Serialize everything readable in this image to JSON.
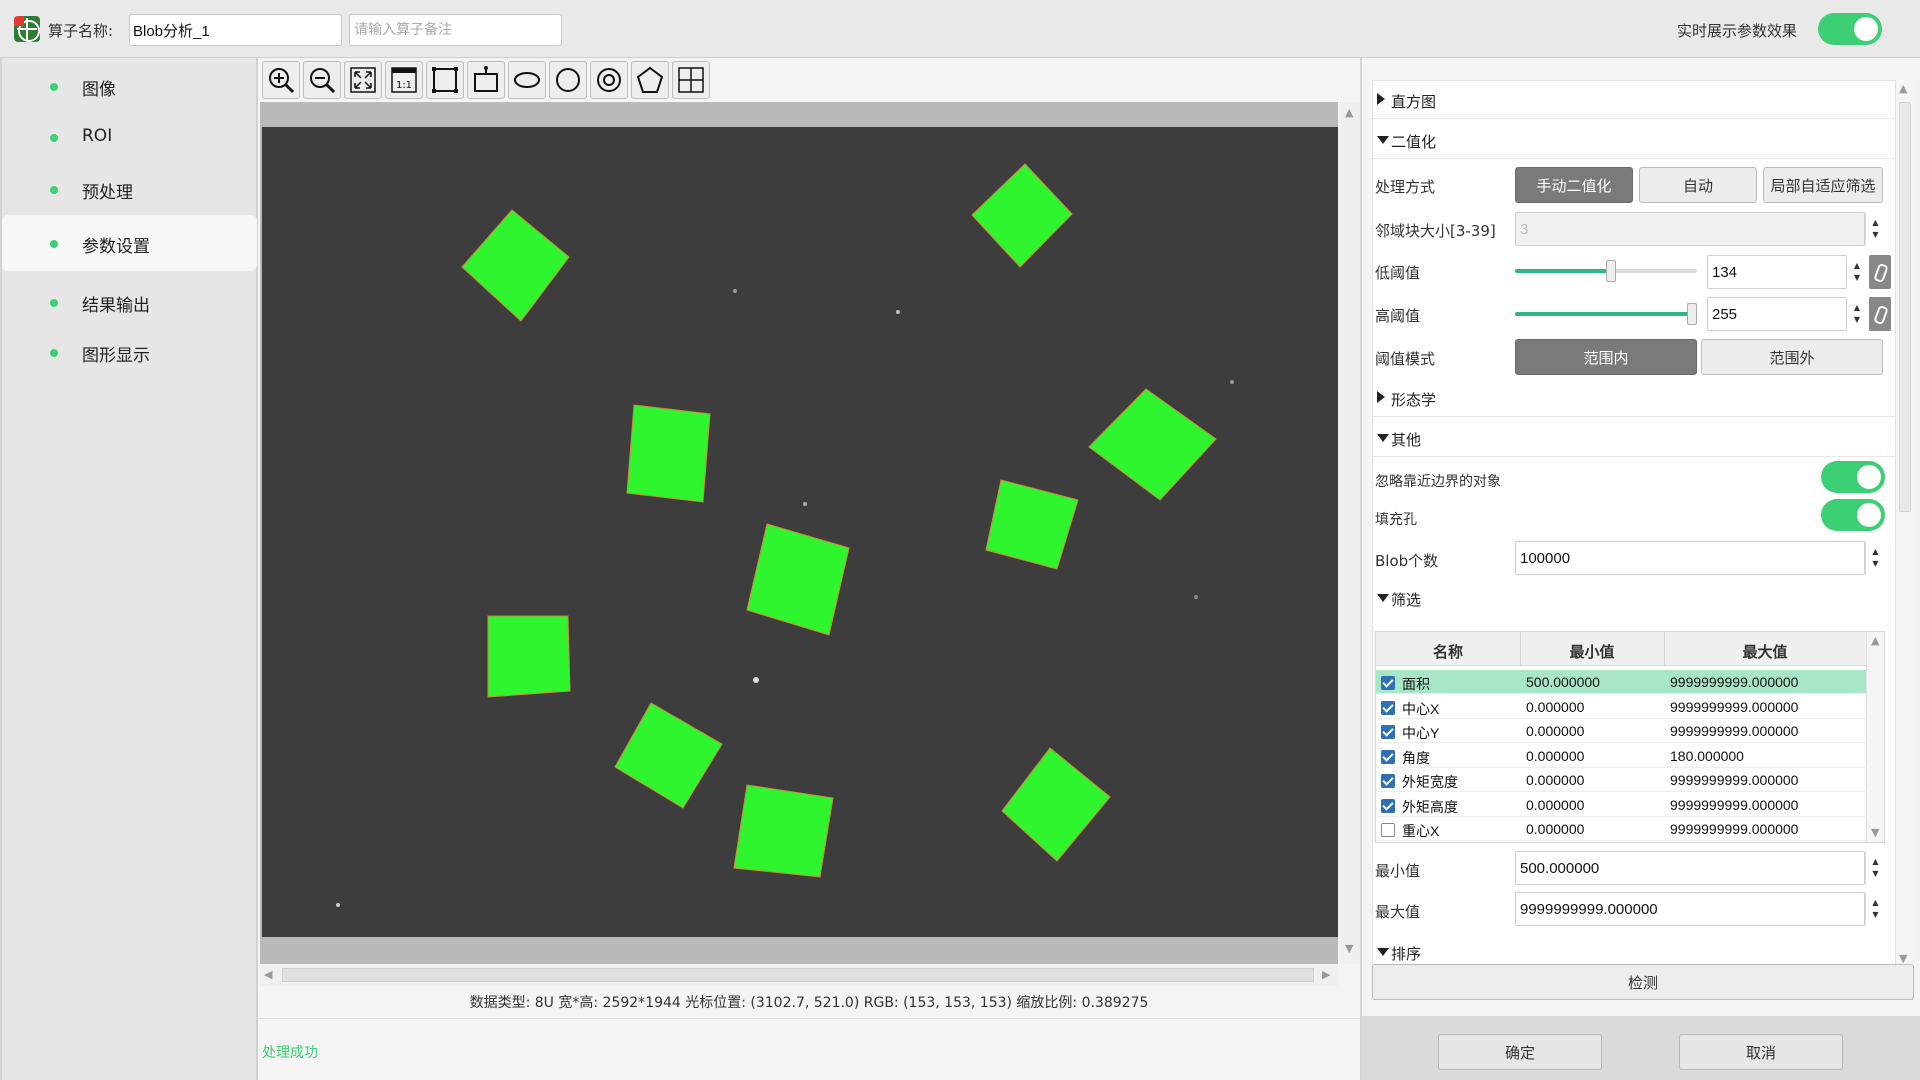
{
  "topbar": {
    "op_name_label": "算子名称:",
    "op_name_value": "Blob分析_1",
    "op_note_placeholder": "请输入算子备注",
    "realtime_label": "实时展示参数效果",
    "realtime_on": true
  },
  "nav": {
    "items": [
      {
        "label": "图像",
        "active": false
      },
      {
        "label": "ROI",
        "active": false
      },
      {
        "label": "预处理",
        "active": false
      },
      {
        "label": "参数设置",
        "active": true
      },
      {
        "label": "结果输出",
        "active": false
      },
      {
        "label": "图形显示",
        "active": false
      }
    ]
  },
  "toolbar": {
    "icons": [
      "zoom-in-icon",
      "zoom-out-icon",
      "fit-window-icon",
      "actual-size-icon",
      "rectangle-icon",
      "rotated-rect-icon",
      "ellipse-icon",
      "circle-icon",
      "annulus-icon",
      "polygon-icon",
      "grid-icon"
    ]
  },
  "status": {
    "info": "数据类型: 8U 宽*高: 2592*1944 光标位置: (3102.7, 521.0) RGB: (153, 153, 153) 缩放比例: 0.389275",
    "result": "处理成功"
  },
  "params": {
    "histogram": "直方图",
    "binarization": "二值化",
    "method_label": "处理方式",
    "methods": [
      "手动二值化",
      "自动",
      "局部自适应筛选"
    ],
    "method_selected": 0,
    "neighbor_label": "邻域块大小[3-39]",
    "neighbor_value": "3",
    "low_label": "低阈值",
    "low_value": "134",
    "low_fraction": 0.525,
    "high_label": "高阈值",
    "high_value": "255",
    "high_fraction": 1.0,
    "mode_label": "阈值模式",
    "modes": [
      "范围内",
      "范围外"
    ],
    "mode_selected": 0,
    "morphology": "形态学",
    "other": "其他",
    "ignore_border_label": "忽略靠近边界的对象",
    "ignore_border_on": true,
    "fill_holes_label": "填充孔",
    "fill_holes_on": true,
    "blob_count_label": "Blob个数",
    "blob_count_value": "100000",
    "filter": "筛选",
    "table_headers": [
      "名称",
      "最小值",
      "最大值"
    ],
    "table_rows": [
      {
        "checked": true,
        "name": "面积",
        "min": "500.000000",
        "max": "9999999999.000000",
        "selected": true
      },
      {
        "checked": true,
        "name": "中心X",
        "min": "0.000000",
        "max": "9999999999.000000",
        "selected": false
      },
      {
        "checked": true,
        "name": "中心Y",
        "min": "0.000000",
        "max": "9999999999.000000",
        "selected": false
      },
      {
        "checked": true,
        "name": "角度",
        "min": "0.000000",
        "max": "180.000000",
        "selected": false
      },
      {
        "checked": true,
        "name": "外矩宽度",
        "min": "0.000000",
        "max": "9999999999.000000",
        "selected": false
      },
      {
        "checked": true,
        "name": "外矩高度",
        "min": "0.000000",
        "max": "9999999999.000000",
        "selected": false
      },
      {
        "checked": false,
        "name": "重心X",
        "min": "0.000000",
        "max": "9999999999.000000",
        "selected": false
      }
    ],
    "min_label": "最小值",
    "min_value": "500.000000",
    "max_label": "最大值",
    "max_value": "9999999999.000000",
    "sort": "排序"
  },
  "buttons": {
    "detect": "检测",
    "ok": "确定",
    "cancel": "取消"
  },
  "colors": {
    "accent": "#3ccf74",
    "blob_fill": "#2ef52e",
    "canvas_bg": "#3d3d3d",
    "selected_row": "#a8e6c8"
  }
}
